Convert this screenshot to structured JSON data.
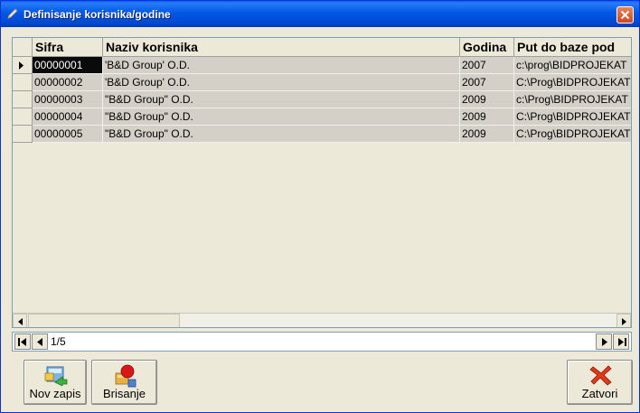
{
  "window": {
    "title": "Definisanje korisnika/godine"
  },
  "grid": {
    "columns": [
      "Sifra",
      "Naziv korisnika",
      "Godina",
      "Put do baze pod"
    ],
    "rows": [
      [
        "00000001",
        "'B&D Group' O.D.",
        "2007",
        "c:\\prog\\BIDPROJEKAT"
      ],
      [
        "00000002",
        "'B&D Group' O.D.",
        "2007",
        "C:\\Prog\\BIDPROJEKAT"
      ],
      [
        "00000003",
        "\"B&D Group\" O.D.",
        "2009",
        "c:\\Prog\\BIDPROJEKAT"
      ],
      [
        "00000004",
        "\"B&D Group\" O.D.",
        "2009",
        "C:\\Prog\\BIDPROJEKAT"
      ],
      [
        "00000005",
        "\"B&D Group\" O.D.",
        "2009",
        "C:\\Prog\\BIDPROJEKAT"
      ]
    ]
  },
  "navigator": {
    "position": "1/5"
  },
  "buttons": {
    "new": "Nov zapis",
    "delete": "Brisanje",
    "close": "Zatvori"
  },
  "icons": {
    "title": "pencil-icon",
    "close": "close-icon",
    "new": "new-record-icon",
    "delete": "delete-record-icon",
    "exit": "red-x-icon"
  },
  "colors": {
    "titlebar": "#0058e6",
    "selection": "#0a0a0a",
    "cell": "#d4d0c8"
  }
}
